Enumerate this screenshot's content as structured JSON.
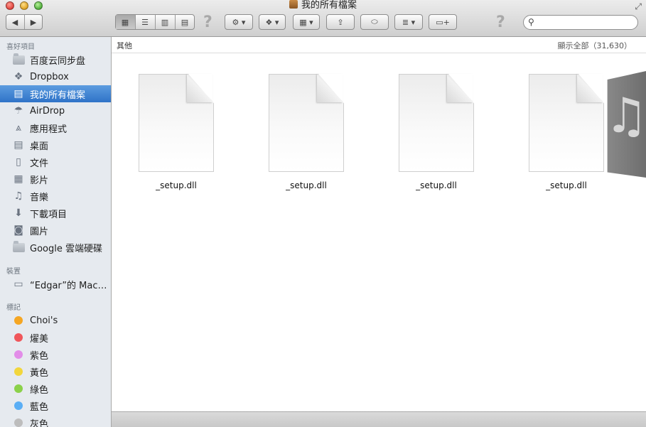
{
  "window": {
    "title": "我的所有檔案"
  },
  "toolbar": {
    "back_icon": "chevron-left-icon",
    "forward_icon": "chevron-right-icon",
    "view_icons": [
      "icon-view-icon",
      "list-view-icon",
      "column-view-icon",
      "coverflow-view-icon"
    ],
    "help1": "?",
    "help2": "?",
    "search_placeholder": ""
  },
  "sidebar": {
    "sections": [
      {
        "title": "喜好項目"
      },
      {
        "title": "裝置"
      },
      {
        "title": "標記"
      }
    ],
    "favorites": [
      {
        "label": "百度云同步盘",
        "icon": "folder-icon"
      },
      {
        "label": "Dropbox",
        "icon": "dropbox-icon"
      },
      {
        "label": "我的所有檔案",
        "icon": "all-files-icon",
        "selected": true
      },
      {
        "label": "AirDrop",
        "icon": "airdrop-icon"
      },
      {
        "label": "應用程式",
        "icon": "applications-icon"
      },
      {
        "label": "桌面",
        "icon": "desktop-icon"
      },
      {
        "label": "文件",
        "icon": "documents-icon"
      },
      {
        "label": "影片",
        "icon": "movies-icon"
      },
      {
        "label": "音樂",
        "icon": "music-icon"
      },
      {
        "label": "下載項目",
        "icon": "downloads-icon"
      },
      {
        "label": "圖片",
        "icon": "pictures-icon"
      },
      {
        "label": "Google 雲端硬碟",
        "icon": "folder-icon"
      }
    ],
    "devices": [
      {
        "label": "“Edgar”的 Mac…",
        "icon": "laptop-icon"
      }
    ],
    "tags": [
      {
        "label": "Choi's",
        "color": "#f5a623"
      },
      {
        "label": "燿美",
        "color": "#f0565a"
      },
      {
        "label": "紫色",
        "color": "#e28de8"
      },
      {
        "label": "黃色",
        "color": "#f2d63c"
      },
      {
        "label": "綠色",
        "color": "#8bd14a"
      },
      {
        "label": "藍色",
        "color": "#5aaef5"
      },
      {
        "label": "灰色",
        "color": "#bdbdbd"
      }
    ]
  },
  "main": {
    "group_label": "其他",
    "count_label": "顯示全部（31,630）",
    "files": [
      {
        "name": "_setup.dll"
      },
      {
        "name": "_setup.dll"
      },
      {
        "name": "_setup.dll"
      },
      {
        "name": "_setup.dll"
      }
    ]
  }
}
